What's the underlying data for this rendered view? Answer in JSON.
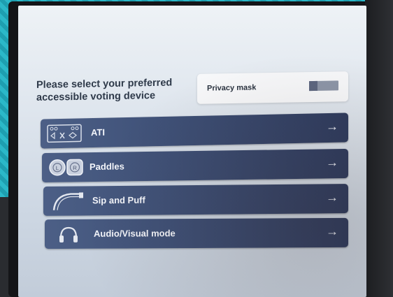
{
  "heading": {
    "line1": "Please select your preferred",
    "line2": "accessible voting device"
  },
  "privacy": {
    "label": "Privacy mask",
    "enabled": false
  },
  "options": [
    {
      "label": "ATI",
      "icon": "ati-keypad-icon"
    },
    {
      "label": "Paddles",
      "icon": "paddles-icon"
    },
    {
      "label": "Sip and Puff",
      "icon": "sip-puff-icon"
    },
    {
      "label": "Audio/Visual mode",
      "icon": "headphones-icon"
    }
  ],
  "paddle_icon_letters": [
    "L",
    "R"
  ],
  "arrow_glyph": "→",
  "colors": {
    "button_bg": "#3f5178",
    "screen_bg": "#dfe6ee",
    "heading_text": "#2f3a4a"
  }
}
